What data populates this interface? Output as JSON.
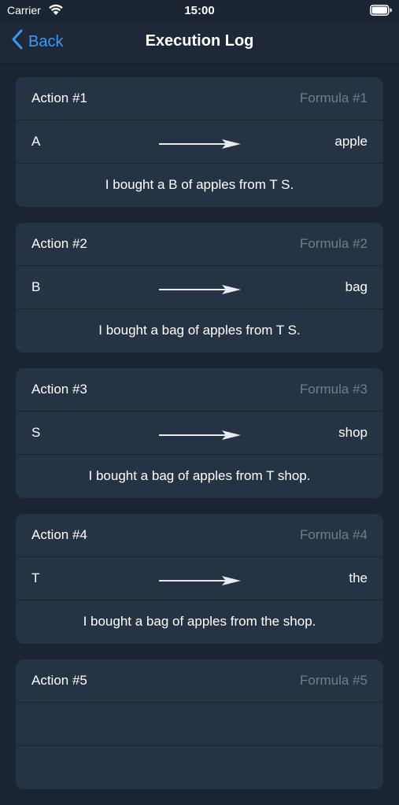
{
  "status_bar": {
    "carrier": "Carrier",
    "time": "15:00"
  },
  "nav": {
    "back_label": "Back",
    "title": "Execution Log"
  },
  "colors": {
    "background": "#1b2431",
    "card": "#253345",
    "accent": "#3a9af5",
    "muted_text": "#747d89"
  },
  "actions": [
    {
      "action": "Action #1",
      "formula": "Formula #1",
      "symbol": "A",
      "replacement": "apple",
      "result": "I bought a B of apples from T S."
    },
    {
      "action": "Action #2",
      "formula": "Formula #2",
      "symbol": "B",
      "replacement": "bag",
      "result": "I bought a bag of apples from T S."
    },
    {
      "action": "Action #3",
      "formula": "Formula #3",
      "symbol": "S",
      "replacement": "shop",
      "result": "I bought a bag of apples from T shop."
    },
    {
      "action": "Action #4",
      "formula": "Formula #4",
      "symbol": "T",
      "replacement": "the",
      "result": "I bought a bag of apples from the shop."
    },
    {
      "action": "Action #5",
      "formula": "Formula #5",
      "symbol": "",
      "replacement": "",
      "result": ""
    }
  ]
}
